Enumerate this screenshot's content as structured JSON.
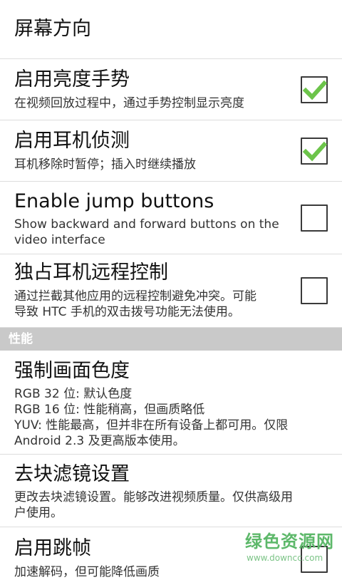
{
  "prefs": {
    "orientation": {
      "title": "屏幕方向"
    },
    "brightness": {
      "title": "启用亮度手势",
      "summary": "在视频回放过程中，通过手势控制显示亮度",
      "checked": true
    },
    "headset": {
      "title": "启用耳机侦测",
      "summary": "耳机移除时暂停；插入时继续播放",
      "checked": true
    },
    "jump": {
      "title": "Enable jump buttons",
      "summary_lines": [
        "Show backward and forward buttons on the",
        "video interface"
      ],
      "checked": false
    },
    "remote": {
      "title": "独占耳机远程控制",
      "summary_lines": [
        "通过拦截其他应用的远程控制避免冲突。可能",
        "导致 HTC 手机的双击拨号功能无法使用。"
      ],
      "checked": false
    },
    "chroma": {
      "title": "强制画面色度",
      "summary_lines": [
        "RGB 32 位: 默认色度",
        "RGB 16 位: 性能稍高，但画质略低",
        "YUV: 性能最高，但并非在所有设备上都可用。仅限",
        "Android 2.3 及更高版本使用。"
      ]
    },
    "deblock": {
      "title": "去块滤镜设置",
      "summary_lines": [
        "更改去块滤镜设置。能够改进视频质量。仅供高级用",
        "户使用。"
      ]
    },
    "frameskip": {
      "title": "启用跳帧",
      "summary": "加速解码，但可能降低画质",
      "checked": false
    }
  },
  "sections": {
    "performance": "性能"
  },
  "watermark": {
    "title": "绿色资源网",
    "url": "www.downcc.com"
  },
  "colors": {
    "check": "#6cc44a",
    "section_bg": "#c9c9c9",
    "divider": "#dddddd",
    "watermark": "#5db86a"
  },
  "icons": {
    "checked": "checkmark-icon"
  }
}
